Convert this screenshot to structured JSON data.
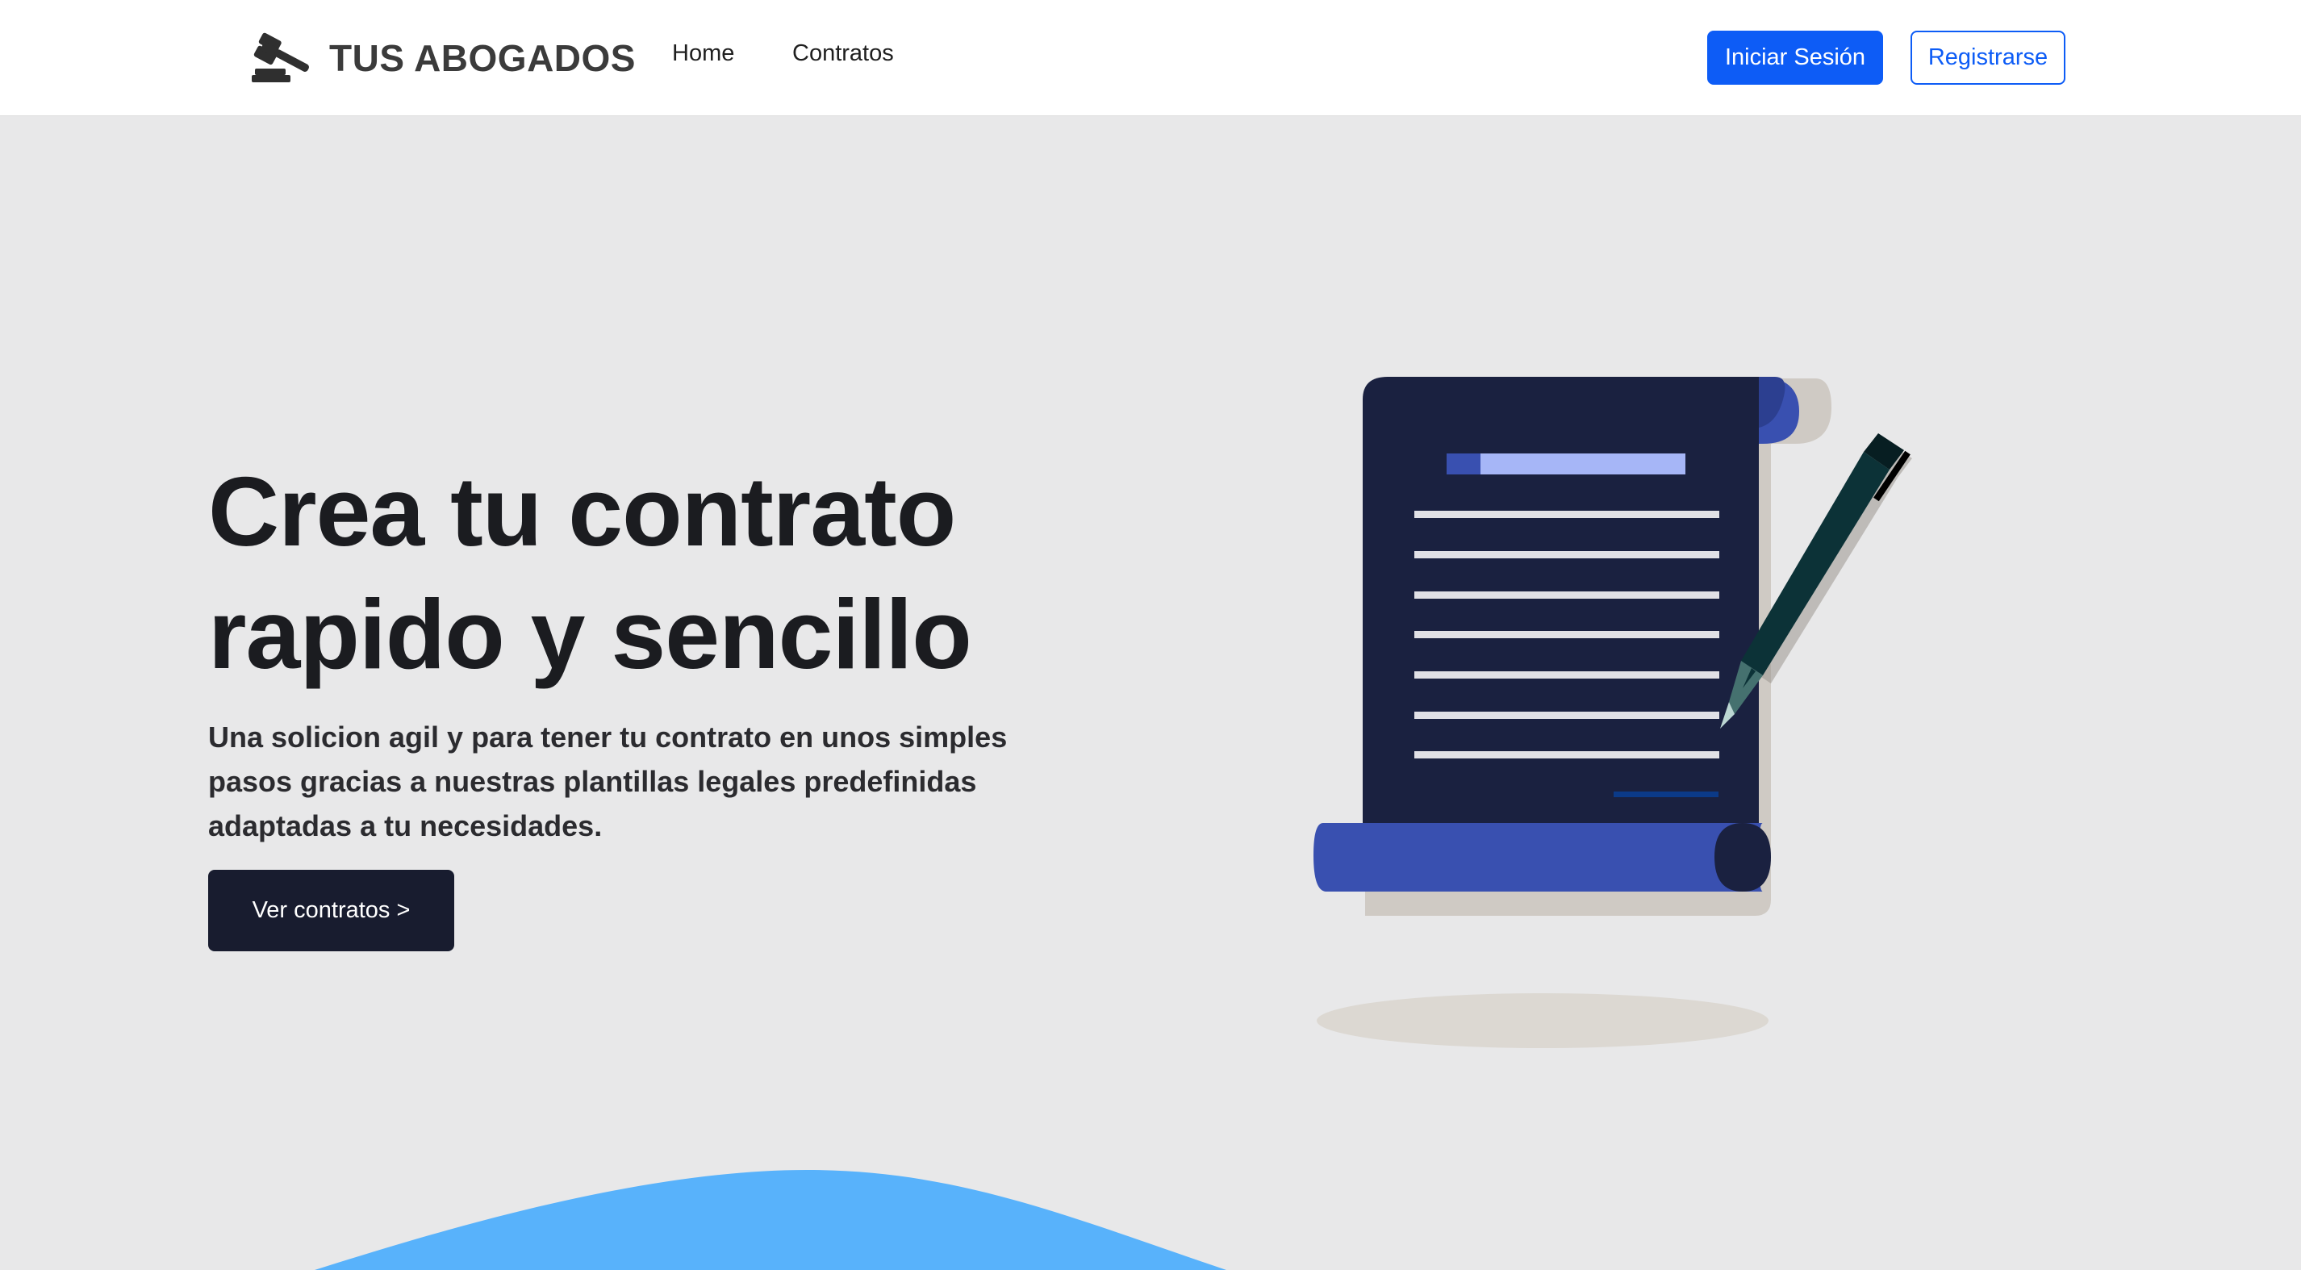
{
  "navbar": {
    "brand": {
      "name": "TUS ABOGADOS",
      "icon": "gavel-icon"
    },
    "links": [
      {
        "label": "Home"
      },
      {
        "label": "Contratos"
      }
    ],
    "login_label": "Iniciar Sesión",
    "register_label": "Registrarse"
  },
  "hero": {
    "title_line1": "Crea tu contrato",
    "title_line2": "rapido y sencillo",
    "subtitle": "Una solicion agil y para tener tu contrato en unos simples pasos gracias a nuestras plantillas legales predefinidas adaptadas a tu necesidades.",
    "cta_label": "Ver contratos >",
    "illustration": "contract-scroll-with-pen-illustration"
  },
  "colors": {
    "primary": "#0d5cf6",
    "dark": "#181c2f",
    "background": "#e8e8e9",
    "scroll_blue": "#3950b0",
    "wave_blue": "#58b2fb"
  }
}
